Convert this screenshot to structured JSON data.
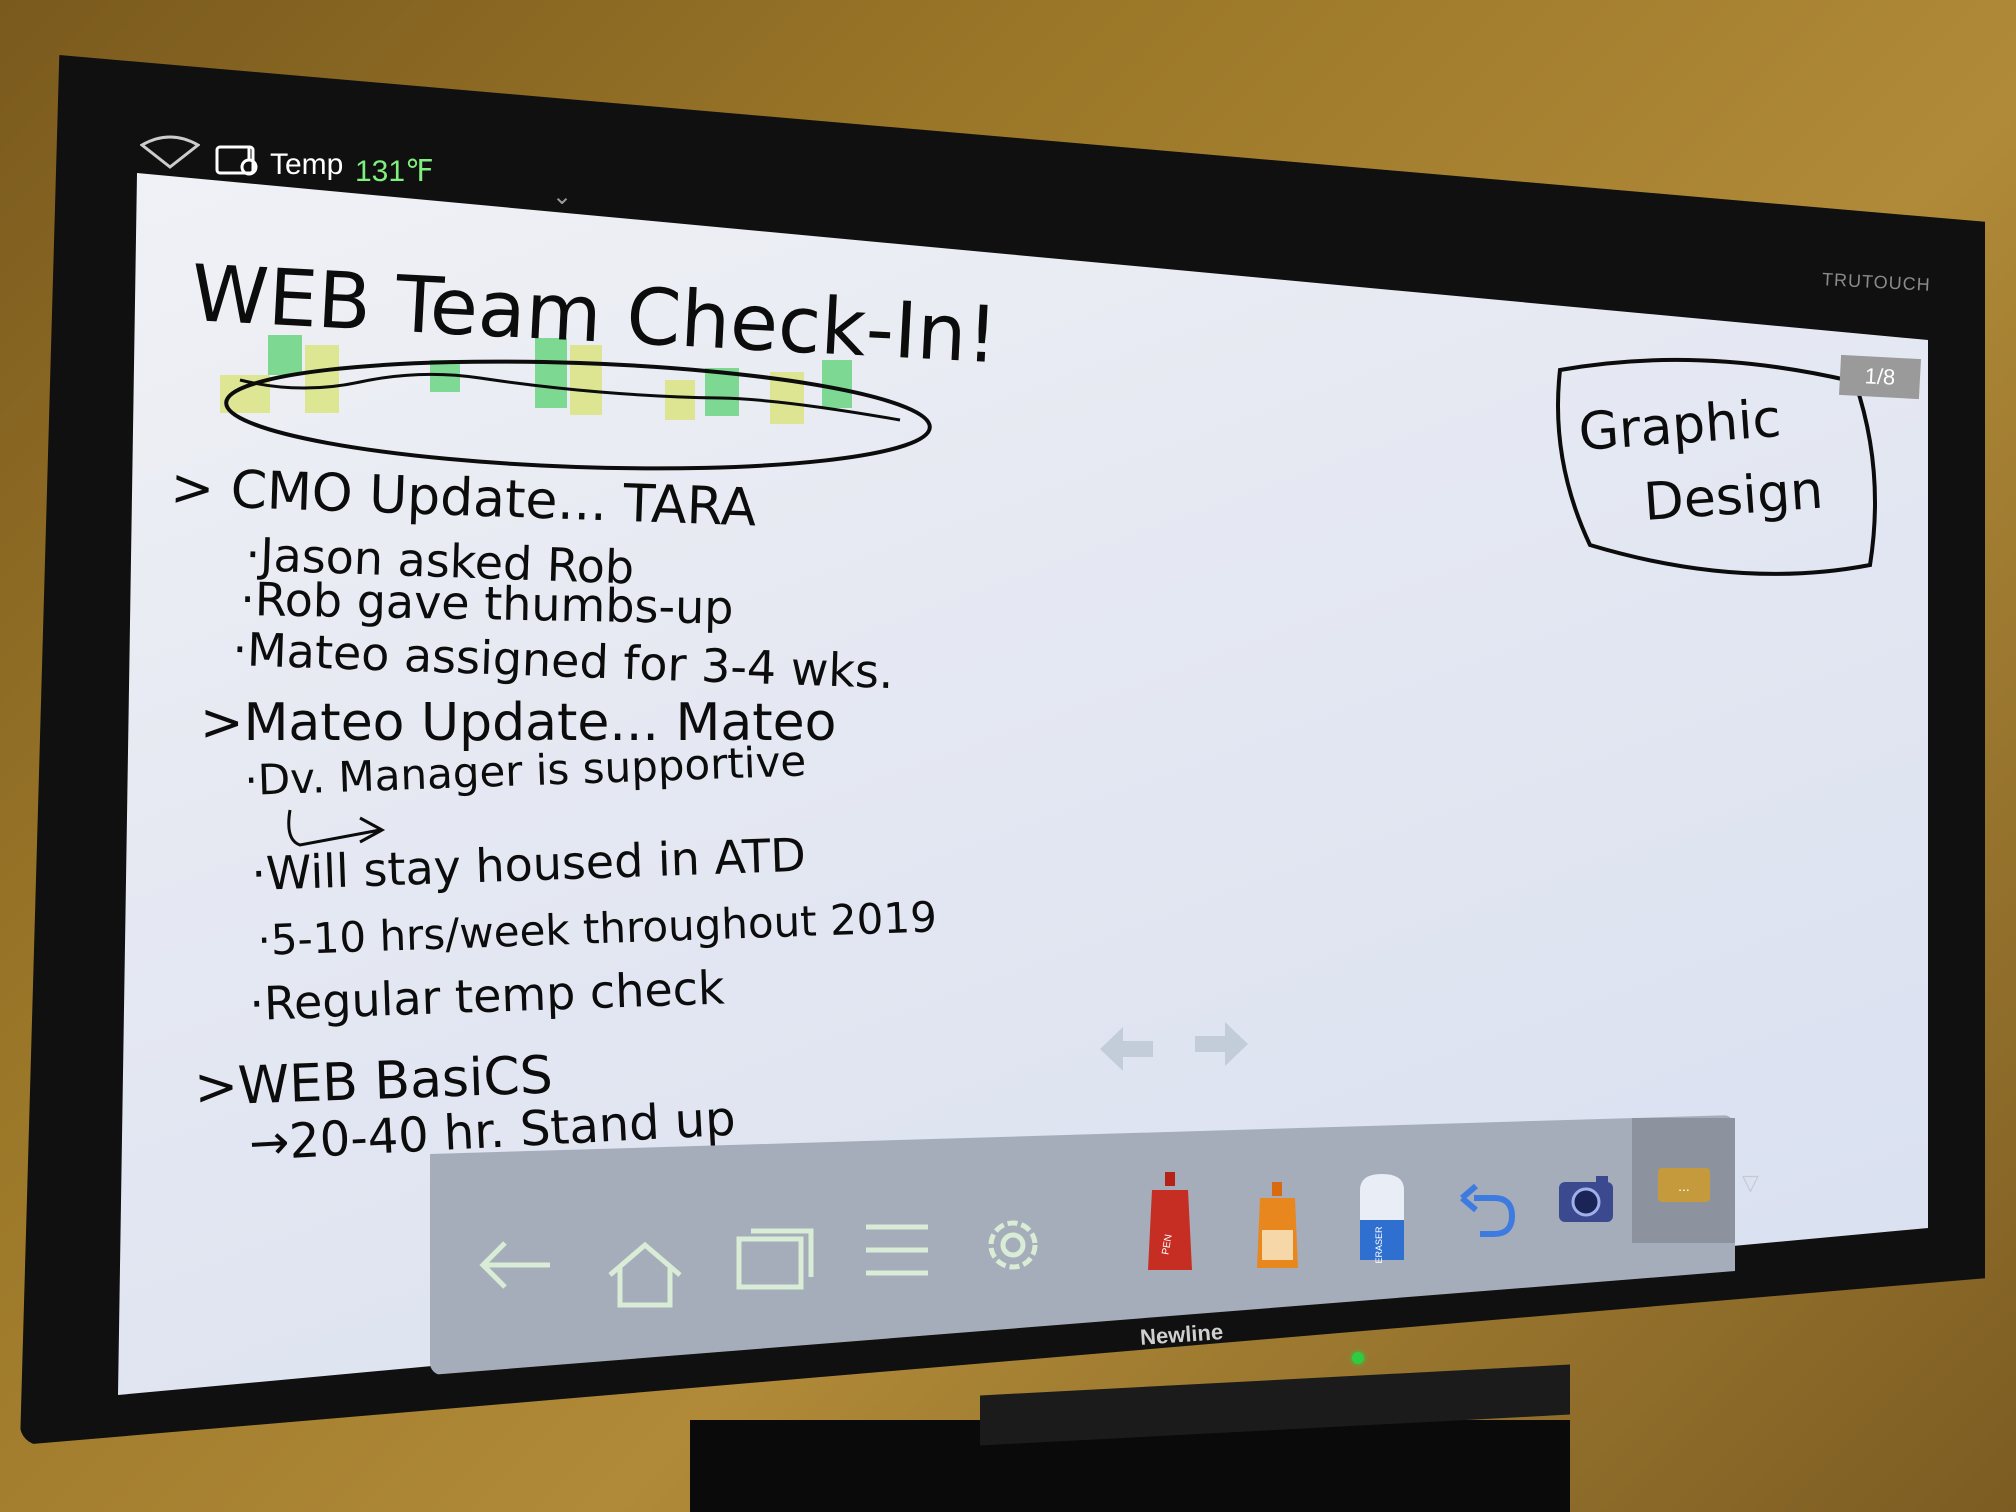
{
  "device": {
    "brand_side": "TRUTOUCH",
    "brand_bottom": "Newline"
  },
  "status_bar": {
    "wifi_icon": "wifi-icon",
    "temp_icon": "thermometer-icon",
    "temp_label": "Temp",
    "temp_value": "131℉",
    "chevron": "⌄"
  },
  "page_counter": "1/8",
  "whiteboard": {
    "title": "WEB Team Check-In!",
    "sections": [
      {
        "heading": "> CMO Update... TARA",
        "items": [
          "·Jason asked Rob",
          "·Rob gave thumbs-up",
          "·Mateo assigned for 3-4 wks."
        ]
      },
      {
        "heading": ">Mateo Update... Mateo",
        "items": [
          "·Dv. Manager is supportive",
          "·Will stay housed in ATD",
          "·5-10 hrs/week throughout 2019",
          "·Regular temp check"
        ]
      },
      {
        "heading": ">WEB BasiCS",
        "items": [
          "→20-40 hr. Stand up"
        ]
      }
    ],
    "boxed_note_line1": "Graphic",
    "boxed_note_line2": "Design"
  },
  "nav": {
    "prev_icon": "arrow-left-icon",
    "next_icon": "arrow-right-icon"
  },
  "toolbar": {
    "back_icon": "back-arrow-icon",
    "home_icon": "home-icon",
    "windows_icon": "windows-icon",
    "menu_icon": "list-menu-icon",
    "settings_icon": "gear-icon",
    "pen_label": "PEN",
    "highlighter_icon": "highlighter-icon",
    "eraser_label": "ERASER",
    "undo_icon": "undo-icon",
    "camera_icon": "camera-icon",
    "more_label": "...",
    "collapse_icon": "▽"
  },
  "colors": {
    "pen_red": "#c62d23",
    "highlighter_orange": "#e8871d",
    "eraser_blue": "#2f6fd0",
    "undo_blue": "#3d7be0",
    "temp_green": "#7ef07e",
    "highlight_green": "#4fd06a",
    "highlight_yellow": "#d8e36a"
  }
}
